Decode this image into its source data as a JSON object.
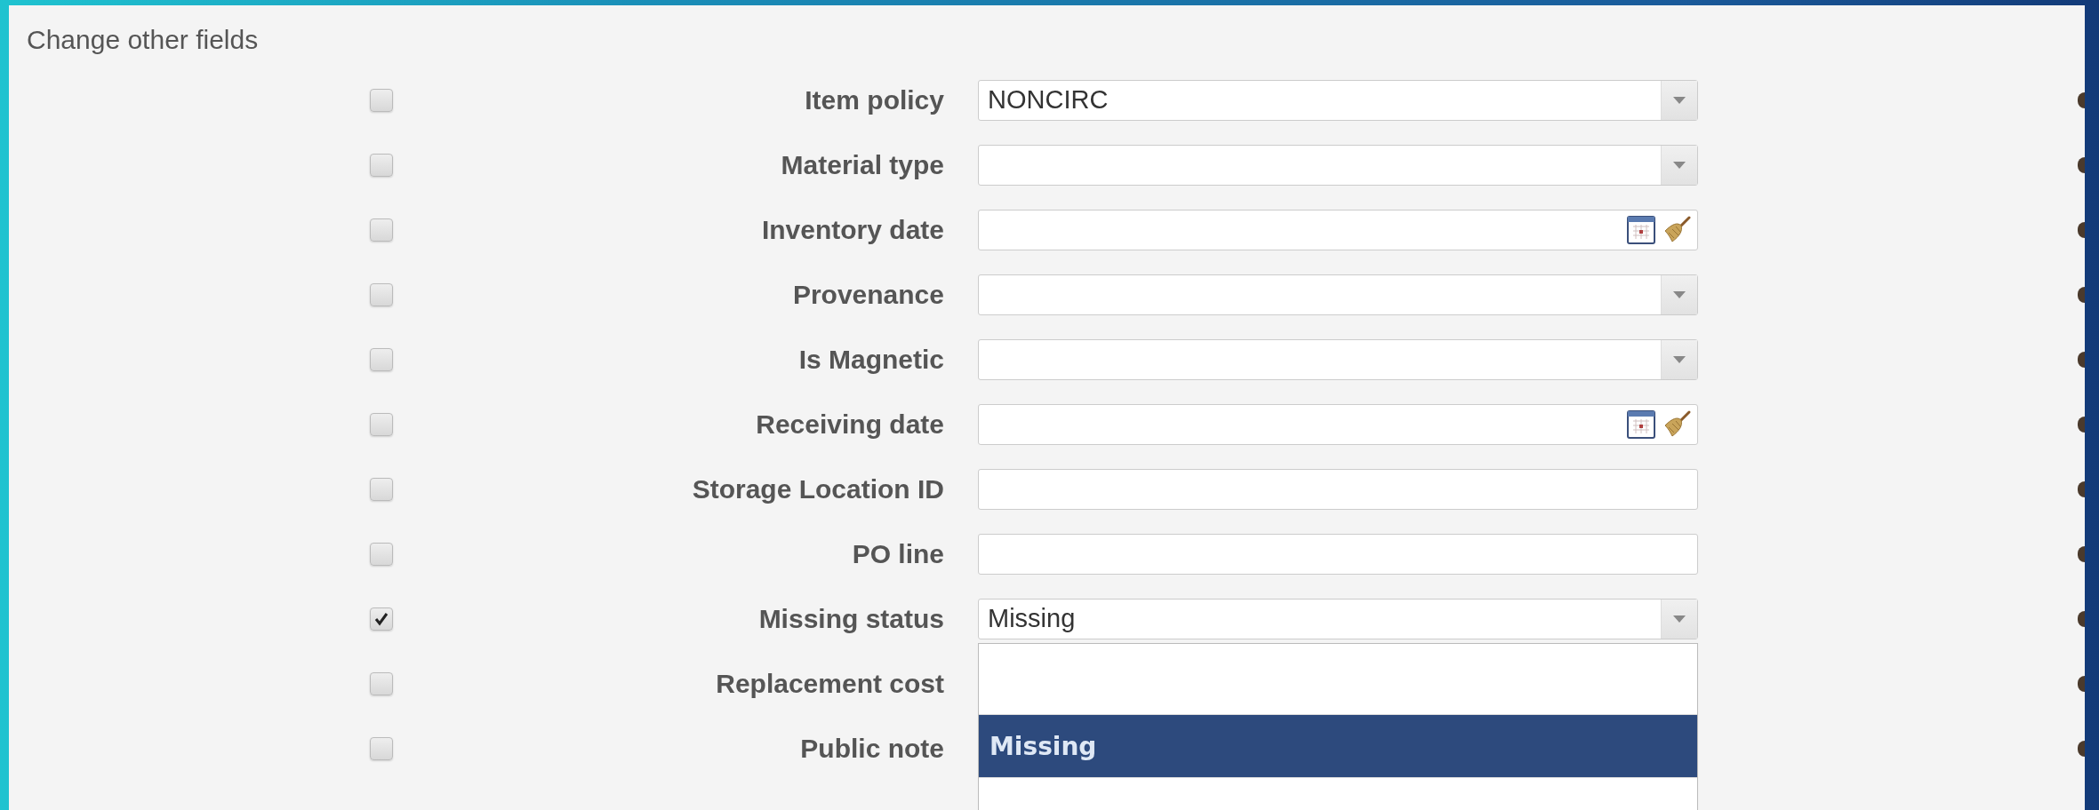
{
  "heading": "Change other fields",
  "rows": [
    {
      "label": "Item policy",
      "checked": false,
      "kind": "select",
      "value": "NONCIRC"
    },
    {
      "label": "Material type",
      "checked": false,
      "kind": "select"
    },
    {
      "label": "Inventory date",
      "checked": false,
      "kind": "date"
    },
    {
      "label": "Provenance",
      "checked": false,
      "kind": "select"
    },
    {
      "label": "Is Magnetic",
      "checked": false,
      "kind": "select"
    },
    {
      "label": "Receiving date",
      "checked": false,
      "kind": "date"
    },
    {
      "label": "Storage Location ID",
      "checked": false,
      "kind": "text"
    },
    {
      "label": "PO line",
      "checked": false,
      "kind": "text"
    },
    {
      "label": "Missing status",
      "checked": true,
      "kind": "select",
      "value": "Missing",
      "options": [
        {
          "label": "Missing",
          "selected": true
        }
      ]
    },
    {
      "label": "Replacement cost",
      "checked": false
    },
    {
      "label": "Public note",
      "checked": false
    }
  ]
}
